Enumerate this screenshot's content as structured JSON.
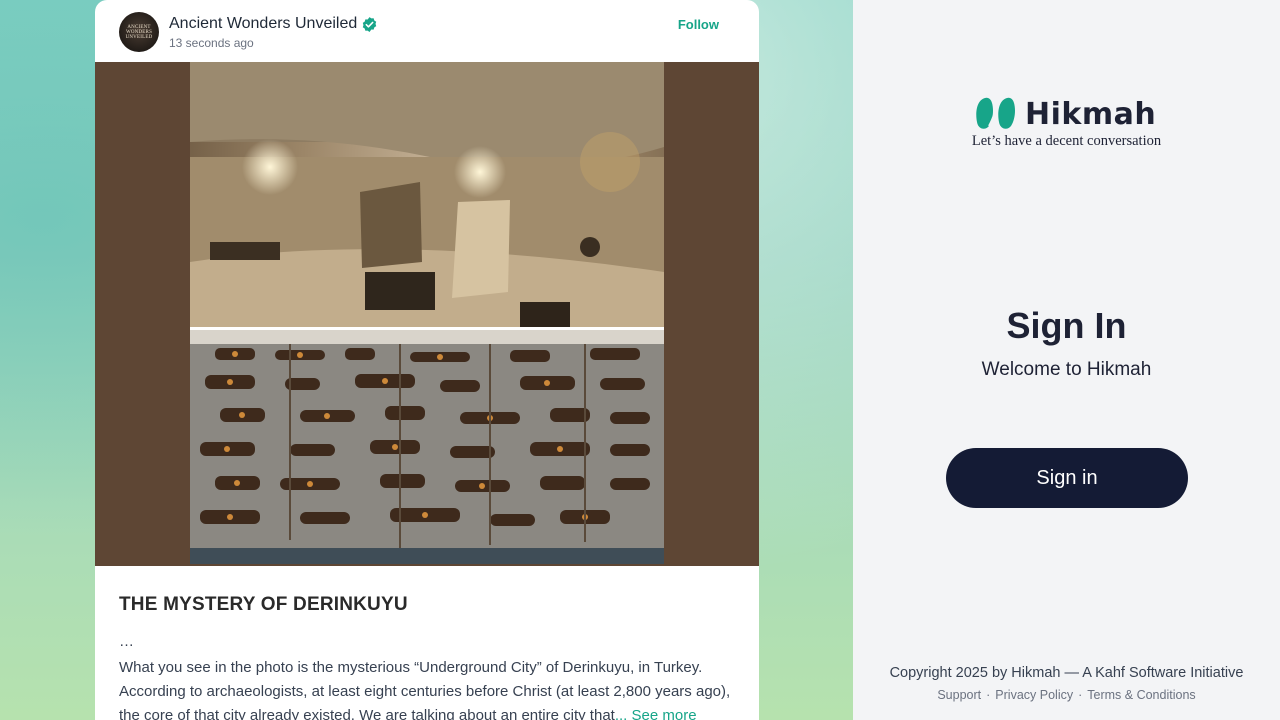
{
  "post": {
    "author": {
      "name": "Ancient Wonders Unveiled",
      "avatar_text": "ANCIENT WONDERS UNVEILED",
      "verified": true,
      "time": "13 seconds ago"
    },
    "follow_label": "Follow",
    "title": "THE MYSTERY OF DERINKUYU",
    "ellipsis": "…",
    "body": "What you see in the photo is the mysterious “Underground City” of Derinkuyu, in Turkey. According to archaeologists, at least eight centuries before Christ (at least 2,800 years ago), the core of that city already existed. We are talking about an entire city that",
    "see_more_label": "... See more"
  },
  "auth": {
    "brand_name": "Hikmah",
    "tagline": "Let’s have a decent conversation",
    "title": "Sign In",
    "subtitle": "Welcome to Hikmah",
    "signin_button": "Sign in"
  },
  "footer": {
    "copyright": "Copyright 2025 by Hikmah — A Kahf Software Initiative",
    "links": [
      "Support",
      "Privacy Policy",
      "Terms & Conditions"
    ],
    "separator": "·"
  },
  "colors": {
    "accent": "#17a589",
    "navy": "#141b35",
    "media_bg": "#5e4634"
  }
}
